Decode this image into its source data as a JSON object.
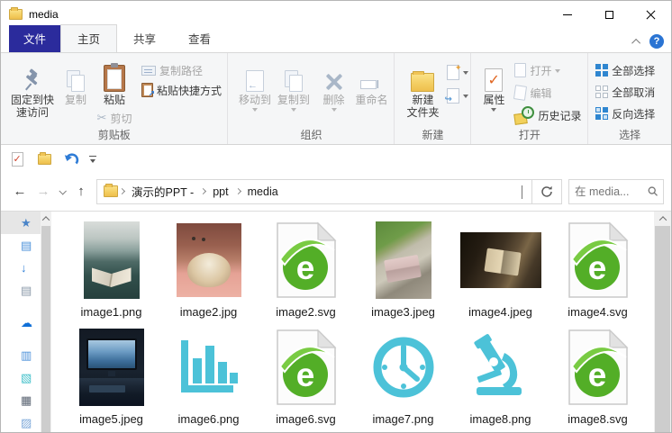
{
  "window": {
    "title": "media"
  },
  "tabs": {
    "file": "文件",
    "home": "主页",
    "share": "共享",
    "view": "查看",
    "help_glyph": "?"
  },
  "ribbon": {
    "clipboard": {
      "group_label": "剪贴板",
      "pin_label": "固定到快\n速访问",
      "copy_label": "复制",
      "paste_label": "粘贴",
      "cut_label": "剪切",
      "copy_path_label": "复制路径",
      "paste_shortcut_label": "粘贴快捷方式"
    },
    "organize": {
      "group_label": "组织",
      "move_to_label": "移动到",
      "copy_to_label": "复制到",
      "delete_label": "删除",
      "rename_label": "重命名"
    },
    "new": {
      "group_label": "新建",
      "new_folder_label": "新建\n文件夹"
    },
    "open": {
      "group_label": "打开",
      "properties_label": "属性",
      "open_label": "打开",
      "edit_label": "编辑",
      "history_label": "历史记录"
    },
    "select": {
      "group_label": "选择",
      "select_all_label": "全部选择",
      "select_none_label": "全部取消",
      "invert_label": "反向选择"
    }
  },
  "address": {
    "back_glyph": "←",
    "forward_glyph": "→",
    "up_glyph": "↑",
    "crumb1": "演示的PPT -",
    "crumb2": "ppt",
    "crumb3": "media"
  },
  "search": {
    "placeholder": "在 media..."
  },
  "files": [
    {
      "name": "image1.png",
      "kind": "photo-open-book-ocean"
    },
    {
      "name": "image2.jpg",
      "kind": "photo-hamster"
    },
    {
      "name": "image2.svg",
      "kind": "browser-e-logo-page"
    },
    {
      "name": "image3.jpeg",
      "kind": "photo-laptop-outdoors"
    },
    {
      "name": "image4.jpeg",
      "kind": "photo-reading-dark"
    },
    {
      "name": "image4.svg",
      "kind": "browser-e-logo-page"
    },
    {
      "name": "image5.jpeg",
      "kind": "photo-desk-monitor"
    },
    {
      "name": "image6.png",
      "kind": "teal-bar-chart-icon"
    },
    {
      "name": "image6.svg",
      "kind": "browser-e-logo-page"
    },
    {
      "name": "image7.png",
      "kind": "teal-clock-icon"
    },
    {
      "name": "image8.png",
      "kind": "teal-microscope-icon"
    },
    {
      "name": "image8.svg",
      "kind": "browser-e-logo-page"
    }
  ],
  "icons": {
    "titlebar": [
      "folder-icon",
      "minimize-icon",
      "maximize-icon",
      "close-icon"
    ],
    "quick_access_toolbar": [
      "properties-icon",
      "new-folder-icon",
      "undo-icon",
      "customize-toolbar-icon"
    ],
    "address_bar": [
      "back-icon",
      "forward-icon",
      "recent-locations-icon",
      "up-icon",
      "folder-icon",
      "refresh-icon",
      "search-icon"
    ],
    "nav_pane": [
      "quick-access-star-icon",
      "desktop-icon",
      "downloads-icon",
      "documents-icon",
      "onedrive-cloud-icon",
      "this-pc-icon",
      "objects-icon",
      "videos-icon",
      "pictures-icon"
    ]
  },
  "colors": {
    "file_tab_blue": "#2b2b9c",
    "help_blue": "#2a74d3",
    "teal_icon": "#4cc2d8",
    "elogo_green": "#53ae27",
    "folder_yellow": "#f3cd60",
    "select_grid_blue": "#2f86d0",
    "undo_blue": "#2f7cd6"
  }
}
